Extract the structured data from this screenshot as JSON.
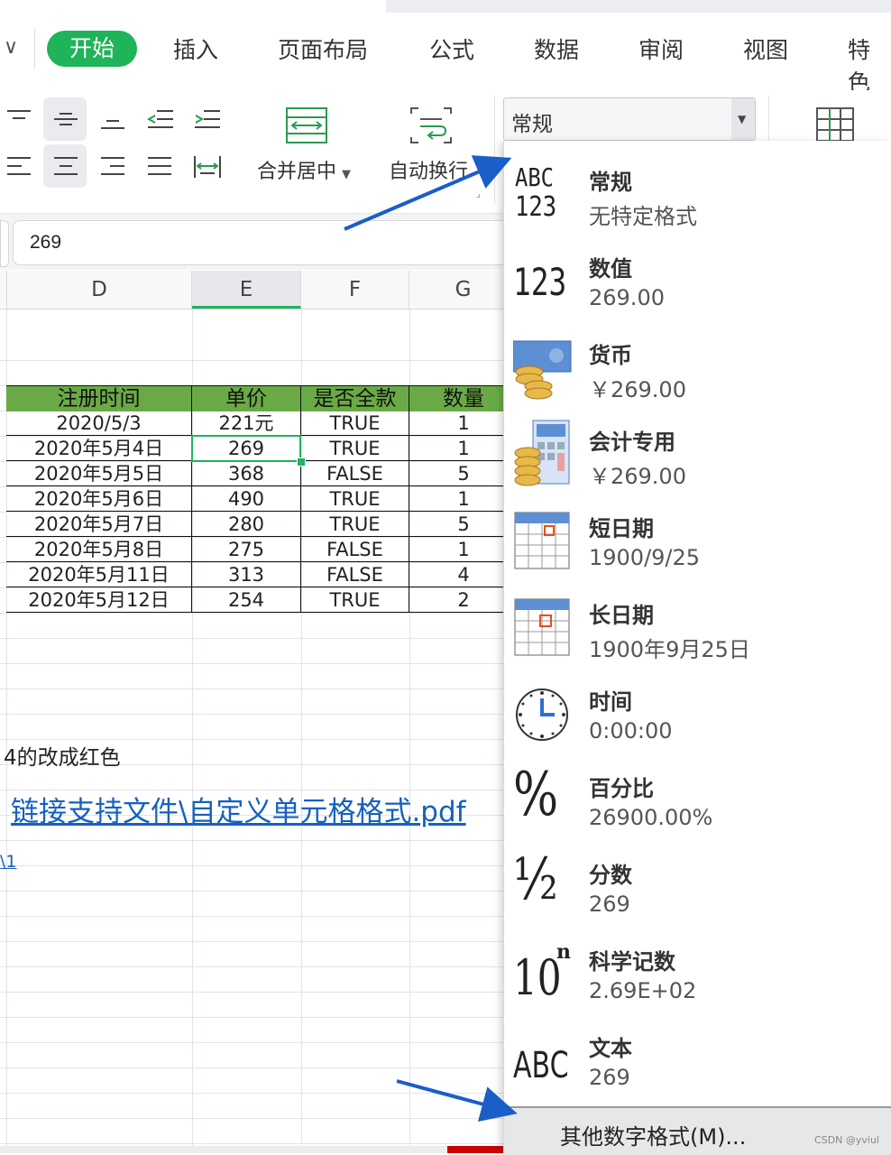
{
  "ribbon": {
    "tabs": [
      "开始",
      "插入",
      "页面布局",
      "公式",
      "数据",
      "审阅",
      "视图",
      "特色"
    ],
    "collapse_icon": "chevron-down-icon"
  },
  "toolbar": {
    "merge_label": "合并居中",
    "wrap_label": "自动换行",
    "number_format_value": "常规"
  },
  "formula_bar": {
    "value": "269"
  },
  "columns": [
    "D",
    "E",
    "F",
    "G"
  ],
  "table": {
    "headers": [
      "注册时间",
      "单价",
      "是否全款",
      "数量"
    ],
    "rows": [
      [
        "2020/5/3",
        "221元",
        "TRUE",
        "1"
      ],
      [
        "2020年5月4日",
        "269",
        "TRUE",
        "1"
      ],
      [
        "2020年5月5日",
        "368",
        "FALSE",
        "5"
      ],
      [
        "2020年5月6日",
        "490",
        "TRUE",
        "1"
      ],
      [
        "2020年5月7日",
        "280",
        "TRUE",
        "5"
      ],
      [
        "2020年5月8日",
        "275",
        "FALSE",
        "1"
      ],
      [
        "2020年5月11日",
        "313",
        "FALSE",
        "4"
      ],
      [
        "2020年5月12日",
        "254",
        "TRUE",
        "2"
      ]
    ],
    "header_color": "#6aaa46"
  },
  "sheet_text": {
    "note": "4的改成红色",
    "link1": "链接支持文件\\自定义单元格格式.pdf",
    "link2": "\\1"
  },
  "format_menu": {
    "items": [
      {
        "name": "常规",
        "example": "无特定格式",
        "icon": "abc-123-icon"
      },
      {
        "name": "数值",
        "example": "269.00",
        "icon": "number-icon"
      },
      {
        "name": "货币",
        "example": "￥269.00",
        "icon": "currency-coins-icon"
      },
      {
        "name": "会计专用",
        "example": " ￥269.00",
        "icon": "accounting-calculator-icon"
      },
      {
        "name": "短日期",
        "example": "1900/9/25",
        "icon": "calendar-icon"
      },
      {
        "name": "长日期",
        "example": "1900年9月25日",
        "icon": "calendar-icon"
      },
      {
        "name": "时间",
        "example": "0:00:00",
        "icon": "clock-icon"
      },
      {
        "name": "百分比",
        "example": "26900.00%",
        "icon": "percent-icon"
      },
      {
        "name": "分数",
        "example": "269",
        "icon": "fraction-icon"
      },
      {
        "name": "科学记数",
        "example": "2.69E+02",
        "icon": "scientific-icon"
      },
      {
        "name": "文本",
        "example": "269",
        "icon": "text-abc-icon"
      }
    ],
    "more_label": "其他数字格式(M)..."
  },
  "watermark": "CSDN @yviul",
  "colors": {
    "accent": "#1fb35a",
    "arrow": "#1a5ec8",
    "link": "#1560c0"
  }
}
